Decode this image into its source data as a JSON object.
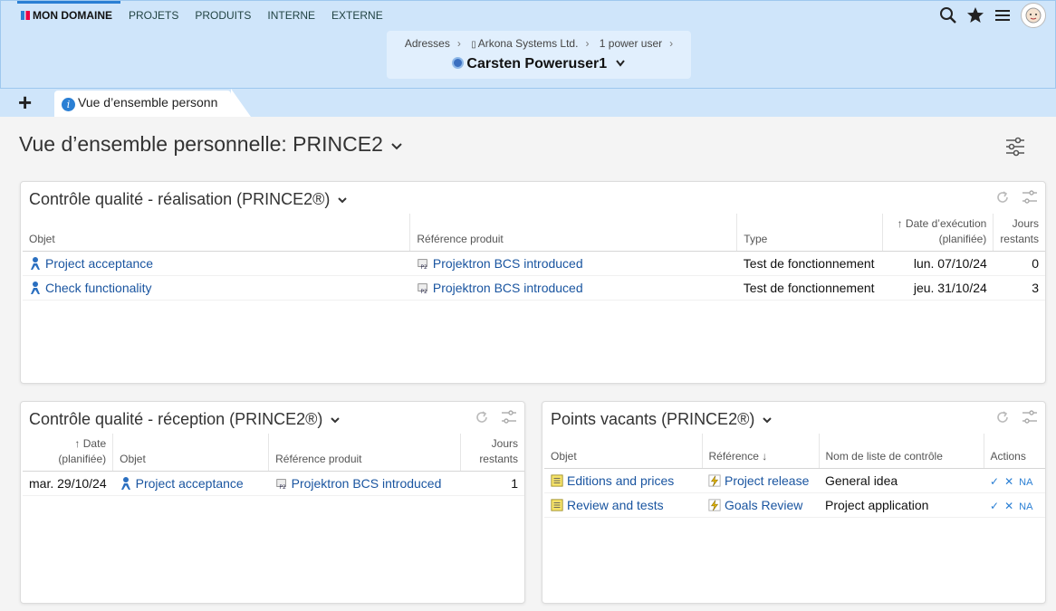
{
  "nav": {
    "items": [
      "MON DOMAINE",
      "PROJETS",
      "PRODUITS",
      "INTERNE",
      "EXTERNE"
    ]
  },
  "header_icons": [
    "search-icon",
    "star-icon",
    "menu-icon",
    "avatar"
  ],
  "breadcrumb": {
    "items": [
      "Adresses",
      "Arkona Systems Ltd.",
      "1 power user"
    ],
    "current": "Carsten Poweruser1"
  },
  "tabs": {
    "active": "Vue d’ensemble personn"
  },
  "page": {
    "title": "Vue d’ensemble personnelle: PRINCE2"
  },
  "panel1": {
    "title": "Contrôle qualité - réalisation (PRINCE2®)",
    "headers": {
      "objet": "Objet",
      "ref": "Référence produit",
      "type": "Type",
      "date1": "Date d’exécution",
      "date2": "(planifiée)",
      "jours1": "Jours",
      "jours2": "restants"
    },
    "rows": [
      {
        "objet": "Project acceptance",
        "ref": "Projektron BCS introduced",
        "type": "Test de fonctionnement",
        "date": "lun. 07/10/24",
        "jours": "0"
      },
      {
        "objet": "Check functionality",
        "ref": "Projektron BCS introduced",
        "type": "Test de fonctionnement",
        "date": "jeu. 31/10/24",
        "jours": "3"
      }
    ]
  },
  "panel2": {
    "title": "Contrôle qualité - réception (PRINCE2®)",
    "headers": {
      "date1": "Date",
      "date2": "(planifiée)",
      "objet": "Objet",
      "ref": "Référence produit",
      "jours1": "Jours",
      "jours2": "restants"
    },
    "rows": [
      {
        "date": "mar. 29/10/24",
        "objet": "Project acceptance",
        "ref": "Projektron BCS introduced",
        "jours": "1"
      }
    ]
  },
  "panel3": {
    "title": "Points vacants (PRINCE2®)",
    "headers": {
      "objet": "Objet",
      "ref": "Référence",
      "liste": "Nom de liste de contrôle",
      "actions": "Actions"
    },
    "rows": [
      {
        "objet": "Editions and prices",
        "ref": "Project release",
        "liste": "General idea",
        "na": "NA"
      },
      {
        "objet": "Review and tests",
        "ref": "Goals Review",
        "liste": "Project application",
        "na": "NA"
      }
    ]
  }
}
